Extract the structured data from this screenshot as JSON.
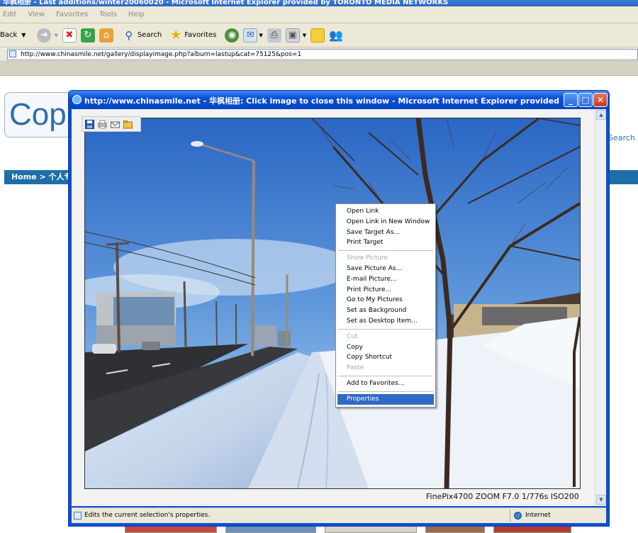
{
  "parent_window": {
    "title": "华枫相册 - Last additions/winter20060020 - Microsoft Internet Explorer provided by TORONTO MEDIA NETWORKS",
    "menu": [
      "Edit",
      "View",
      "Favorites",
      "Tools",
      "Help"
    ],
    "toolbar": {
      "back_label": "Back",
      "search_label": "Search",
      "favorites_label": "Favorites"
    },
    "address": "http://www.chinasmile.net/gallery/displayimage.php?album=lastup&cat=75125&pos=1"
  },
  "page": {
    "logo_text": "Cop",
    "nav_text": "Home > 个人专",
    "search_link": "Search"
  },
  "popup": {
    "title": "http://www.chinasmile.net - 华枫相册: Click image to close this window - Microsoft Internet Explorer provided by TORON...",
    "minimize": "_",
    "maximize": "□",
    "close": "✕",
    "exif_caption": "FinePix4700 ZOOM F7.0 1/776s ISO200",
    "status_text": "Edits the current selection's properties.",
    "status_zone": "Internet"
  },
  "context_menu": {
    "items": [
      {
        "label": "Open Link",
        "state": "normal"
      },
      {
        "label": "Open Link in New Window",
        "state": "normal"
      },
      {
        "label": "Save Target As...",
        "state": "normal"
      },
      {
        "label": "Print Target",
        "state": "normal"
      },
      {
        "separator": true
      },
      {
        "label": "Show Picture",
        "state": "disabled"
      },
      {
        "label": "Save Picture As...",
        "state": "normal"
      },
      {
        "label": "E-mail Picture...",
        "state": "normal"
      },
      {
        "label": "Print Picture...",
        "state": "normal"
      },
      {
        "label": "Go to My Pictures",
        "state": "normal"
      },
      {
        "label": "Set as Background",
        "state": "normal"
      },
      {
        "label": "Set as Desktop Item...",
        "state": "normal"
      },
      {
        "separator": true
      },
      {
        "label": "Cut",
        "state": "disabled"
      },
      {
        "label": "Copy",
        "state": "normal"
      },
      {
        "label": "Copy Shortcut",
        "state": "normal"
      },
      {
        "label": "Paste",
        "state": "disabled"
      },
      {
        "separator": true
      },
      {
        "label": "Add to Favorites...",
        "state": "normal"
      },
      {
        "separator": true
      },
      {
        "label": "Properties",
        "state": "selected"
      }
    ]
  },
  "colors": {
    "xp_blue": "#0b4fd6",
    "menu_highlight": "#316ac5",
    "nav_blue": "#1f6ea8"
  }
}
